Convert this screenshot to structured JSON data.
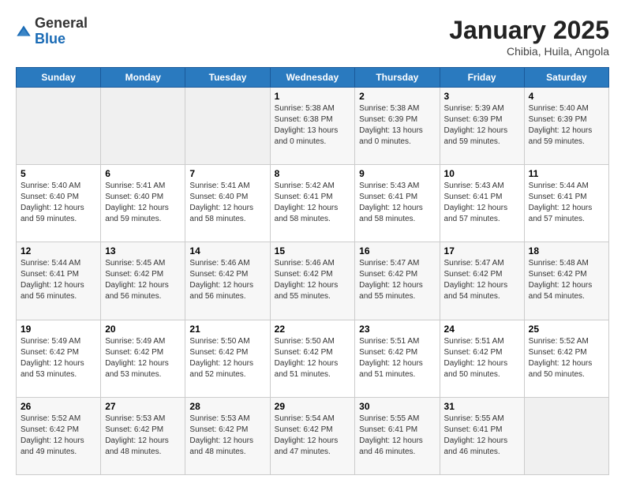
{
  "header": {
    "logo_general": "General",
    "logo_blue": "Blue",
    "month_title": "January 2025",
    "location": "Chibia, Huila, Angola"
  },
  "days_of_week": [
    "Sunday",
    "Monday",
    "Tuesday",
    "Wednesday",
    "Thursday",
    "Friday",
    "Saturday"
  ],
  "weeks": [
    [
      {
        "day": "",
        "info": ""
      },
      {
        "day": "",
        "info": ""
      },
      {
        "day": "",
        "info": ""
      },
      {
        "day": "1",
        "info": "Sunrise: 5:38 AM\nSunset: 6:38 PM\nDaylight: 13 hours\nand 0 minutes."
      },
      {
        "day": "2",
        "info": "Sunrise: 5:38 AM\nSunset: 6:39 PM\nDaylight: 13 hours\nand 0 minutes."
      },
      {
        "day": "3",
        "info": "Sunrise: 5:39 AM\nSunset: 6:39 PM\nDaylight: 12 hours\nand 59 minutes."
      },
      {
        "day": "4",
        "info": "Sunrise: 5:40 AM\nSunset: 6:39 PM\nDaylight: 12 hours\nand 59 minutes."
      }
    ],
    [
      {
        "day": "5",
        "info": "Sunrise: 5:40 AM\nSunset: 6:40 PM\nDaylight: 12 hours\nand 59 minutes."
      },
      {
        "day": "6",
        "info": "Sunrise: 5:41 AM\nSunset: 6:40 PM\nDaylight: 12 hours\nand 59 minutes."
      },
      {
        "day": "7",
        "info": "Sunrise: 5:41 AM\nSunset: 6:40 PM\nDaylight: 12 hours\nand 58 minutes."
      },
      {
        "day": "8",
        "info": "Sunrise: 5:42 AM\nSunset: 6:41 PM\nDaylight: 12 hours\nand 58 minutes."
      },
      {
        "day": "9",
        "info": "Sunrise: 5:43 AM\nSunset: 6:41 PM\nDaylight: 12 hours\nand 58 minutes."
      },
      {
        "day": "10",
        "info": "Sunrise: 5:43 AM\nSunset: 6:41 PM\nDaylight: 12 hours\nand 57 minutes."
      },
      {
        "day": "11",
        "info": "Sunrise: 5:44 AM\nSunset: 6:41 PM\nDaylight: 12 hours\nand 57 minutes."
      }
    ],
    [
      {
        "day": "12",
        "info": "Sunrise: 5:44 AM\nSunset: 6:41 PM\nDaylight: 12 hours\nand 56 minutes."
      },
      {
        "day": "13",
        "info": "Sunrise: 5:45 AM\nSunset: 6:42 PM\nDaylight: 12 hours\nand 56 minutes."
      },
      {
        "day": "14",
        "info": "Sunrise: 5:46 AM\nSunset: 6:42 PM\nDaylight: 12 hours\nand 56 minutes."
      },
      {
        "day": "15",
        "info": "Sunrise: 5:46 AM\nSunset: 6:42 PM\nDaylight: 12 hours\nand 55 minutes."
      },
      {
        "day": "16",
        "info": "Sunrise: 5:47 AM\nSunset: 6:42 PM\nDaylight: 12 hours\nand 55 minutes."
      },
      {
        "day": "17",
        "info": "Sunrise: 5:47 AM\nSunset: 6:42 PM\nDaylight: 12 hours\nand 54 minutes."
      },
      {
        "day": "18",
        "info": "Sunrise: 5:48 AM\nSunset: 6:42 PM\nDaylight: 12 hours\nand 54 minutes."
      }
    ],
    [
      {
        "day": "19",
        "info": "Sunrise: 5:49 AM\nSunset: 6:42 PM\nDaylight: 12 hours\nand 53 minutes."
      },
      {
        "day": "20",
        "info": "Sunrise: 5:49 AM\nSunset: 6:42 PM\nDaylight: 12 hours\nand 53 minutes."
      },
      {
        "day": "21",
        "info": "Sunrise: 5:50 AM\nSunset: 6:42 PM\nDaylight: 12 hours\nand 52 minutes."
      },
      {
        "day": "22",
        "info": "Sunrise: 5:50 AM\nSunset: 6:42 PM\nDaylight: 12 hours\nand 51 minutes."
      },
      {
        "day": "23",
        "info": "Sunrise: 5:51 AM\nSunset: 6:42 PM\nDaylight: 12 hours\nand 51 minutes."
      },
      {
        "day": "24",
        "info": "Sunrise: 5:51 AM\nSunset: 6:42 PM\nDaylight: 12 hours\nand 50 minutes."
      },
      {
        "day": "25",
        "info": "Sunrise: 5:52 AM\nSunset: 6:42 PM\nDaylight: 12 hours\nand 50 minutes."
      }
    ],
    [
      {
        "day": "26",
        "info": "Sunrise: 5:52 AM\nSunset: 6:42 PM\nDaylight: 12 hours\nand 49 minutes."
      },
      {
        "day": "27",
        "info": "Sunrise: 5:53 AM\nSunset: 6:42 PM\nDaylight: 12 hours\nand 48 minutes."
      },
      {
        "day": "28",
        "info": "Sunrise: 5:53 AM\nSunset: 6:42 PM\nDaylight: 12 hours\nand 48 minutes."
      },
      {
        "day": "29",
        "info": "Sunrise: 5:54 AM\nSunset: 6:42 PM\nDaylight: 12 hours\nand 47 minutes."
      },
      {
        "day": "30",
        "info": "Sunrise: 5:55 AM\nSunset: 6:41 PM\nDaylight: 12 hours\nand 46 minutes."
      },
      {
        "day": "31",
        "info": "Sunrise: 5:55 AM\nSunset: 6:41 PM\nDaylight: 12 hours\nand 46 minutes."
      },
      {
        "day": "",
        "info": ""
      }
    ]
  ]
}
